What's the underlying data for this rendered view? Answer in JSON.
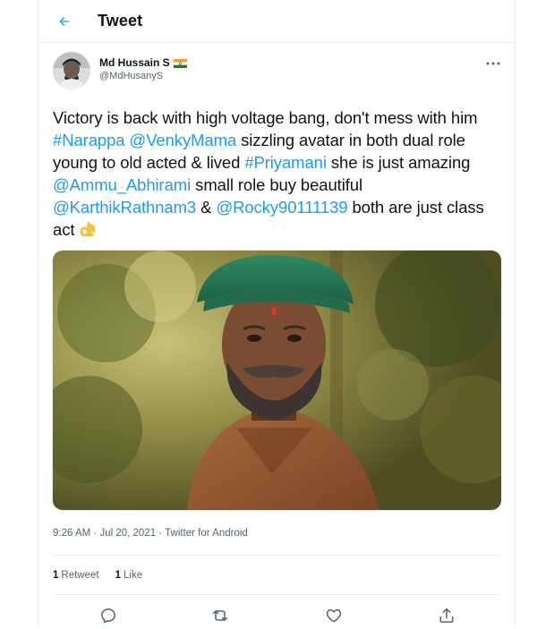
{
  "header": {
    "title": "Tweet",
    "back_icon": "arrow-left-icon"
  },
  "author": {
    "display_name": "Md Hussain S",
    "handle": "@MdHusanyS",
    "flag_icon": "india-flag-icon"
  },
  "tweet": {
    "segments": [
      {
        "text": "Victory is back with high voltage bang, don't mess with him ",
        "type": "text"
      },
      {
        "text": "#Narappa",
        "type": "hashtag"
      },
      {
        "text": " ",
        "type": "text"
      },
      {
        "text": "@VenkyMama",
        "type": "mention"
      },
      {
        "text": " sizzling avatar in both dual role young to old acted & lived ",
        "type": "text"
      },
      {
        "text": "#Priyamani",
        "type": "hashtag"
      },
      {
        "text": " she is just amazing ",
        "type": "text"
      },
      {
        "text": "@Ammu_Abhirami",
        "type": "mention"
      },
      {
        "text": " small role buy beautiful ",
        "type": "text"
      },
      {
        "text": "@KarthikRathnam3",
        "type": "mention"
      },
      {
        "text": " & ",
        "type": "text"
      },
      {
        "text": "@Rocky90111139",
        "type": "mention"
      },
      {
        "text": " both are just class act ",
        "type": "text"
      }
    ],
    "emoji": "ok-hand-emoji"
  },
  "meta": {
    "time": "9:26 AM",
    "date": "Jul 20, 2021",
    "source": "Twitter for Android",
    "separator": " · "
  },
  "stats": {
    "retweets_count": "1",
    "retweets_label": "Retweet",
    "likes_count": "1",
    "likes_label": "Like"
  },
  "actions": [
    "reply-icon",
    "retweet-icon",
    "like-icon",
    "share-icon"
  ],
  "colors": {
    "accent": "#1d9bf0",
    "text": "#0f1419",
    "secondary": "#536471",
    "border": "#e6ecf0"
  }
}
